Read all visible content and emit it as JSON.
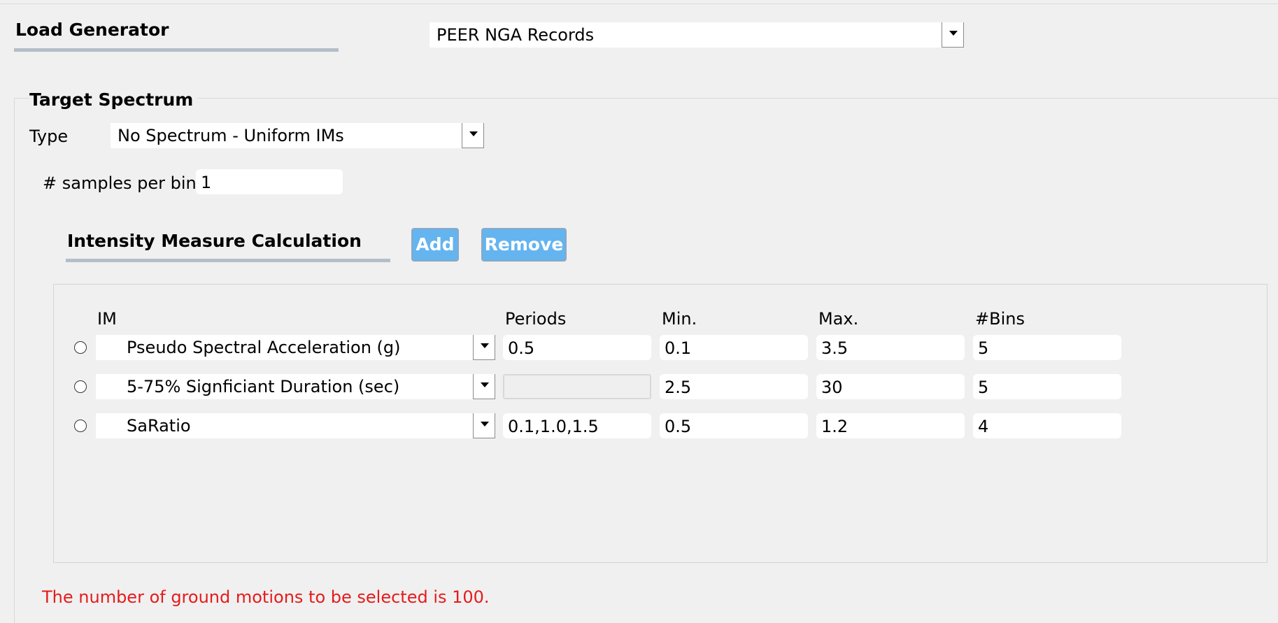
{
  "load_generator": {
    "title": "Load Generator",
    "selected": "PEER NGA Records"
  },
  "target_spectrum": {
    "title": "Target Spectrum",
    "type_label": "Type",
    "type_value": "No Spectrum - Uniform IMs",
    "samples_label": "# samples per bin",
    "samples_value": "1"
  },
  "im_calc": {
    "title": "Intensity Measure Calculation",
    "add_label": "Add",
    "remove_label": "Remove",
    "accent_color": "#64b4f0",
    "headers": {
      "im": "IM",
      "periods": "Periods",
      "min": "Min.",
      "max": "Max.",
      "bins": "#Bins"
    },
    "rows": [
      {
        "im": "Pseudo Spectral Acceleration (g)",
        "periods": "0.5",
        "min": "0.1",
        "max": "3.5",
        "bins": "5"
      },
      {
        "im": "5-75% Signficiant Duration (sec)",
        "periods": "",
        "min": "2.5",
        "max": "30",
        "bins": "5"
      },
      {
        "im": "SaRatio",
        "periods": "0.1,1.0,1.5",
        "min": "0.5",
        "max": "1.2",
        "bins": "4"
      }
    ]
  },
  "status_message": "The number of ground motions to be selected is 100.",
  "status_color": "#e51b1b"
}
